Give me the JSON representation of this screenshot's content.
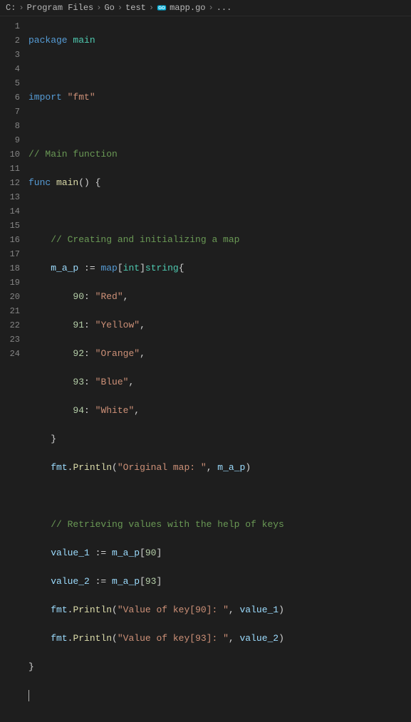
{
  "breadcrumb": {
    "parts": [
      "C:",
      "Program Files",
      "Go",
      "test",
      "mapp.go",
      "..."
    ],
    "sep": "›"
  },
  "gutter": {
    "start": 1,
    "end": 24
  },
  "code": {
    "l1": {
      "kw": "package",
      "pkg": " main"
    },
    "l3": {
      "kw": "import",
      "str": " \"fmt\""
    },
    "l5": {
      "cmt": "// Main function"
    },
    "l6": {
      "kw1": "func",
      "sp": " ",
      "fn": "main",
      "pun": "() {"
    },
    "l8": {
      "cmt": "    // Creating and initializing a map"
    },
    "l9": {
      "ind": "    ",
      "var": "m_a_p",
      "op": " := ",
      "kw": "map",
      "pun1": "[",
      "typ1": "int",
      "pun2": "]",
      "typ2": "string",
      "pun3": "{"
    },
    "l10": {
      "ind": "        ",
      "num": "90",
      "pun": ": ",
      "str": "\"Red\"",
      "comma": ","
    },
    "l11": {
      "ind": "        ",
      "num": "91",
      "pun": ": ",
      "str": "\"Yellow\"",
      "comma": ","
    },
    "l12": {
      "ind": "        ",
      "num": "92",
      "pun": ": ",
      "str": "\"Orange\"",
      "comma": ","
    },
    "l13": {
      "ind": "        ",
      "num": "93",
      "pun": ": ",
      "str": "\"Blue\"",
      "comma": ","
    },
    "l14": {
      "ind": "        ",
      "num": "94",
      "pun": ": ",
      "str": "\"White\"",
      "comma": ","
    },
    "l15": {
      "txt": "    }"
    },
    "l16": {
      "ind": "    ",
      "pkg": "fmt",
      "dot": ".",
      "fn": "Println",
      "pun1": "(",
      "str": "\"Original map: \"",
      "pun2": ", ",
      "var": "m_a_p",
      "pun3": ")"
    },
    "l18": {
      "cmt": "    // Retrieving values with the help of keys"
    },
    "l19": {
      "ind": "    ",
      "var1": "value_1",
      "op": " := ",
      "var2": "m_a_p",
      "pun1": "[",
      "num": "90",
      "pun2": "]"
    },
    "l20": {
      "ind": "    ",
      "var1": "value_2",
      "op": " := ",
      "var2": "m_a_p",
      "pun1": "[",
      "num": "93",
      "pun2": "]"
    },
    "l21": {
      "ind": "    ",
      "pkg": "fmt",
      "dot": ".",
      "fn": "Println",
      "pun1": "(",
      "str": "\"Value of key[90]: \"",
      "pun2": ", ",
      "var": "value_1",
      "pun3": ")"
    },
    "l22": {
      "ind": "    ",
      "pkg": "fmt",
      "dot": ".",
      "fn": "Println",
      "pun1": "(",
      "str": "\"Value of key[93]: \"",
      "pun2": ", ",
      "var": "value_2",
      "pun3": ")"
    },
    "l23": {
      "txt": "}"
    }
  }
}
